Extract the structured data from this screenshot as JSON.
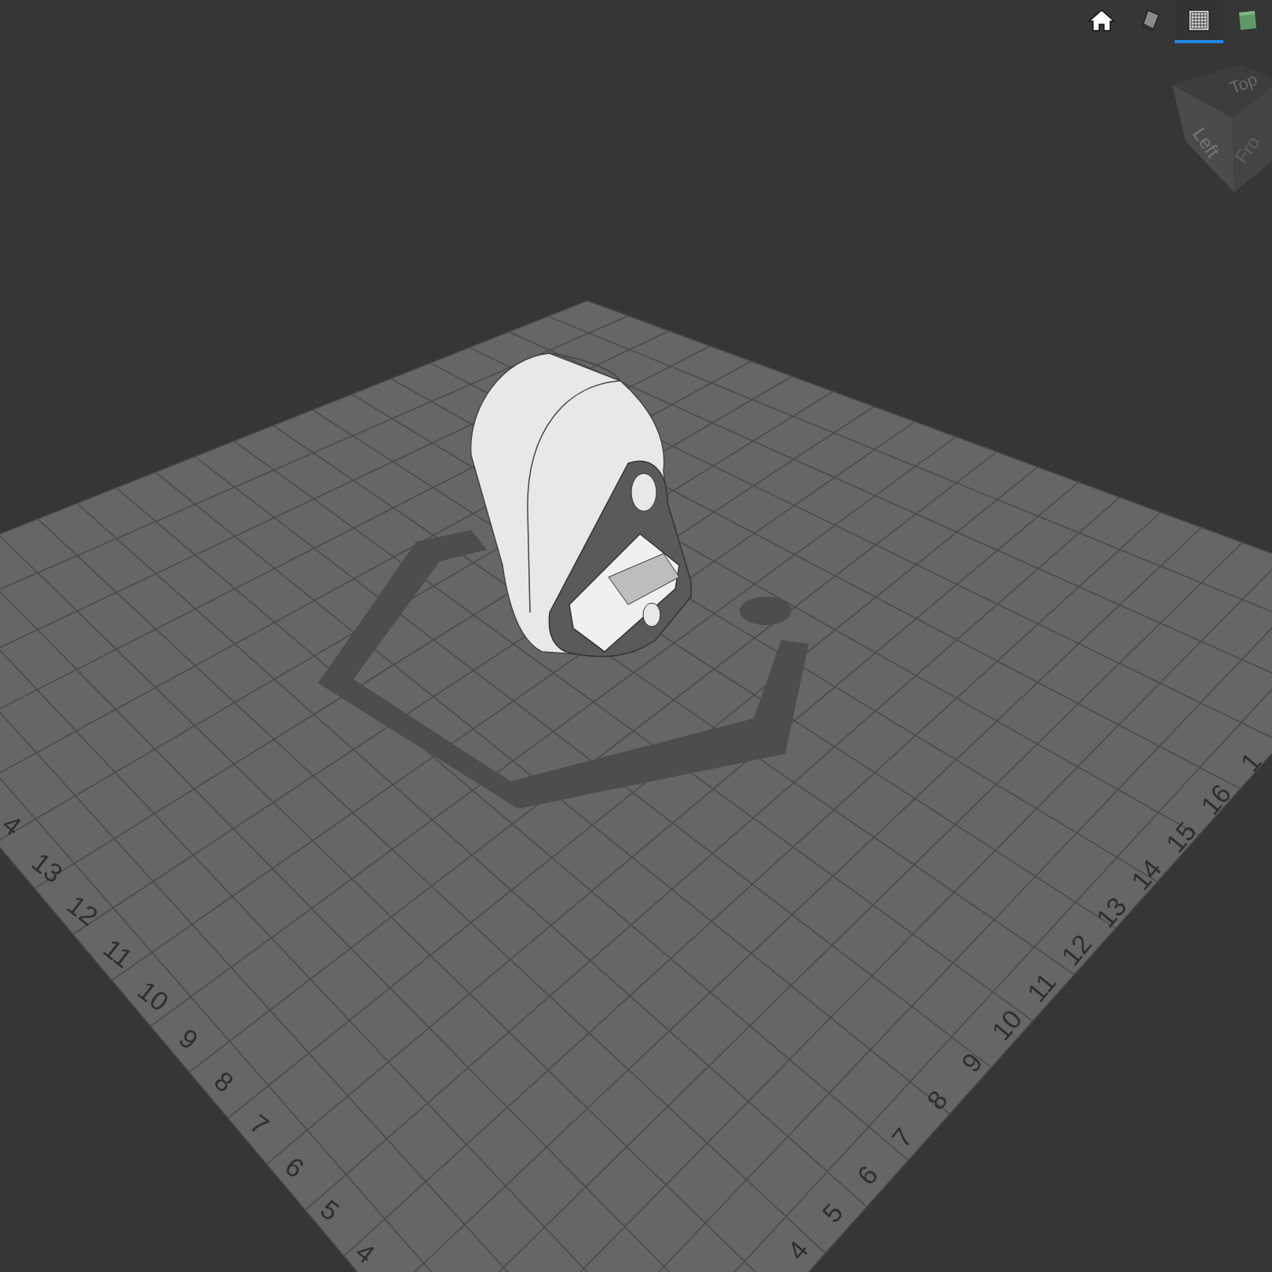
{
  "toolbar": [
    {
      "kind": "home",
      "selected": false
    },
    {
      "kind": "solid",
      "selected": false
    },
    {
      "kind": "grid",
      "selected": true
    },
    {
      "kind": "cube",
      "selected": false
    }
  ],
  "view_cube": {
    "top": "Top",
    "left": "Left",
    "front": "Fro"
  },
  "build_plate": {
    "left_edge_labels": [
      "4",
      "13",
      "12",
      "11",
      "10",
      "9",
      "8",
      "7",
      "6",
      "5",
      "4"
    ],
    "right_edge_labels": [
      "4",
      "5",
      "6",
      "7",
      "8",
      "9",
      "10",
      "11",
      "12",
      "13",
      "14",
      "15",
      "16",
      "1"
    ]
  }
}
